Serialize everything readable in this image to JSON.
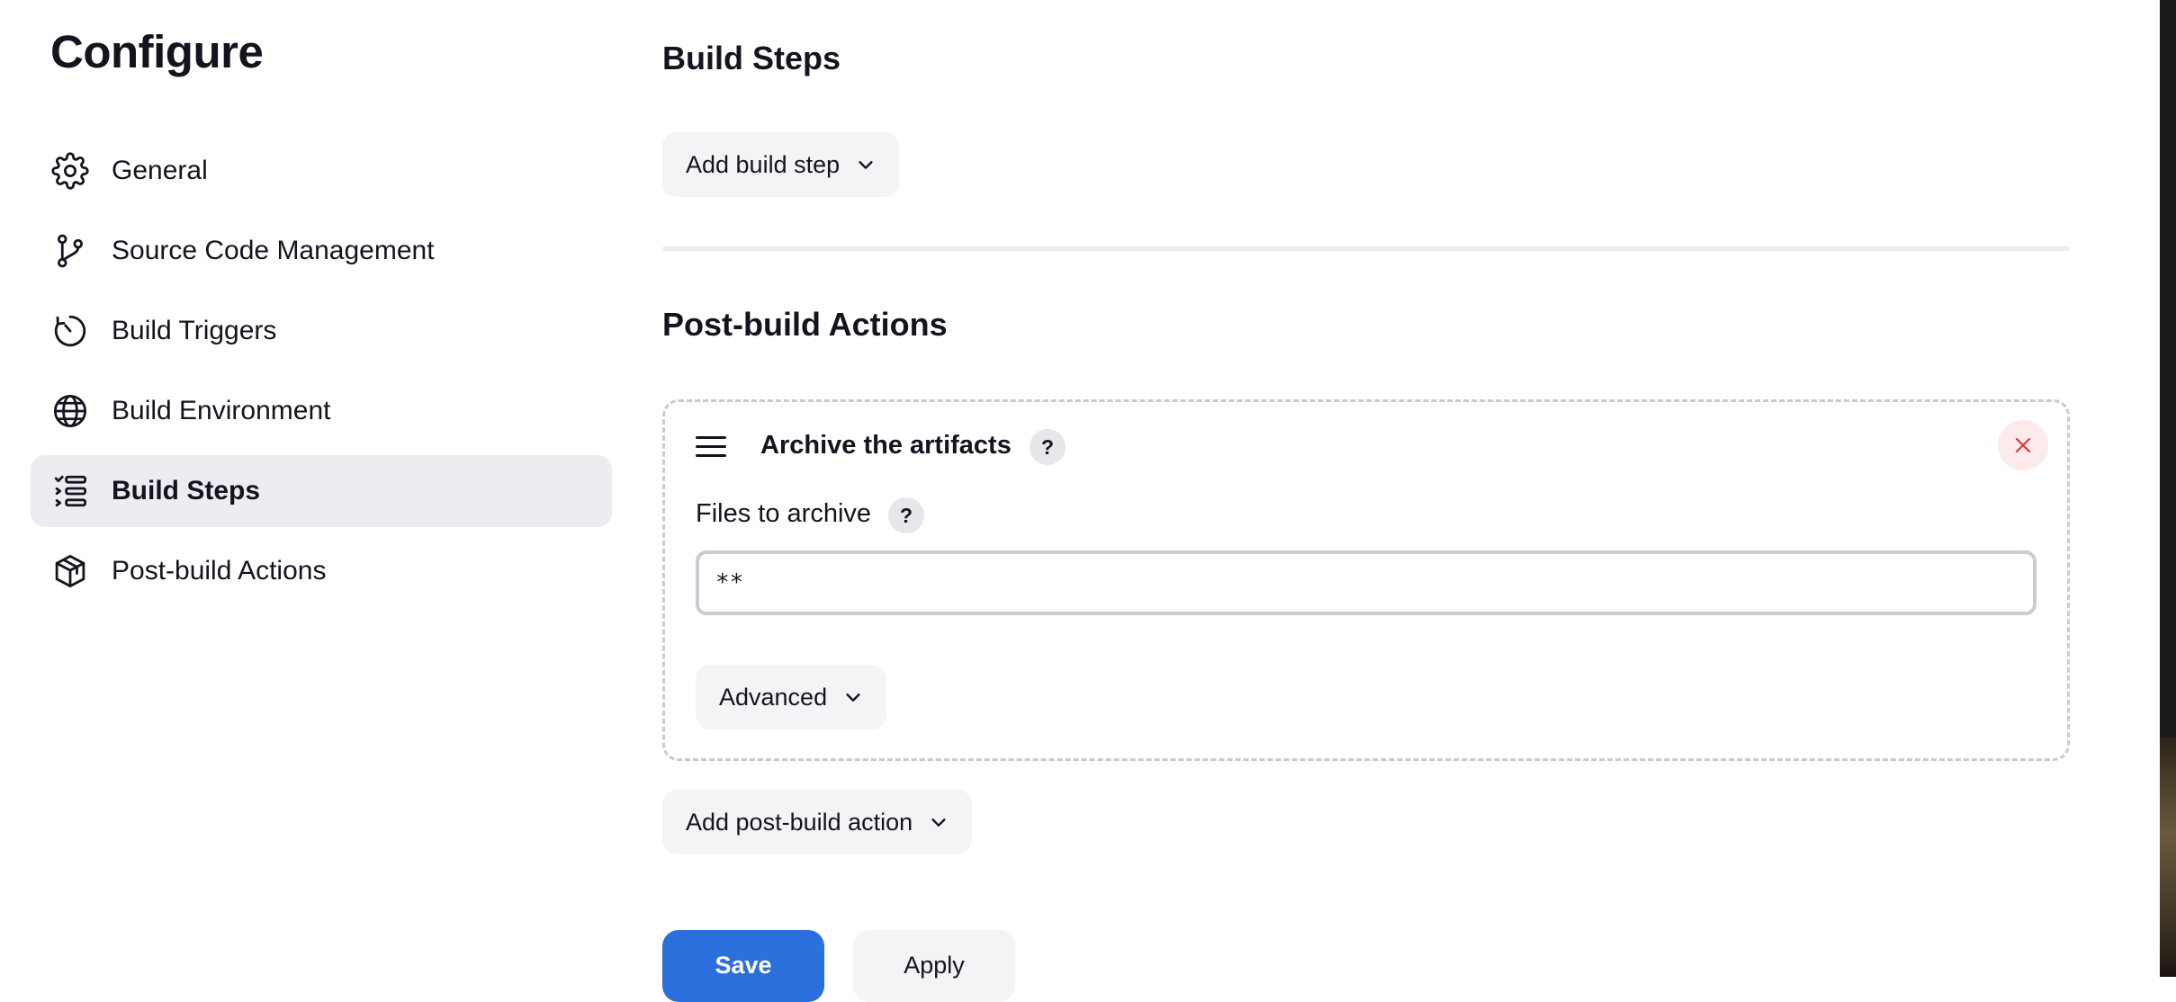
{
  "page": {
    "title": "Configure"
  },
  "sidebar": {
    "items": [
      {
        "label": "General",
        "icon": "gear-icon",
        "active": false
      },
      {
        "label": "Source Code Management",
        "icon": "branch-icon",
        "active": false
      },
      {
        "label": "Build Triggers",
        "icon": "clock-icon",
        "active": false
      },
      {
        "label": "Build Environment",
        "icon": "globe-icon",
        "active": false
      },
      {
        "label": "Build Steps",
        "icon": "list-icon",
        "active": true
      },
      {
        "label": "Post-build Actions",
        "icon": "package-icon",
        "active": false
      }
    ]
  },
  "build_steps": {
    "title": "Build Steps",
    "add_button": "Add build step"
  },
  "post_build": {
    "title": "Post-build Actions",
    "action": {
      "title": "Archive the artifacts",
      "help": "?",
      "field_label": "Files to archive",
      "field_help": "?",
      "field_value": "**",
      "advanced_label": "Advanced"
    },
    "add_button": "Add post-build action"
  },
  "footer": {
    "save_label": "Save",
    "apply_label": "Apply"
  },
  "colors": {
    "accent": "#2a6fdb",
    "active_bg": "#ececf1",
    "button_bg": "#f4f4f7",
    "danger": "#d93a3a"
  }
}
